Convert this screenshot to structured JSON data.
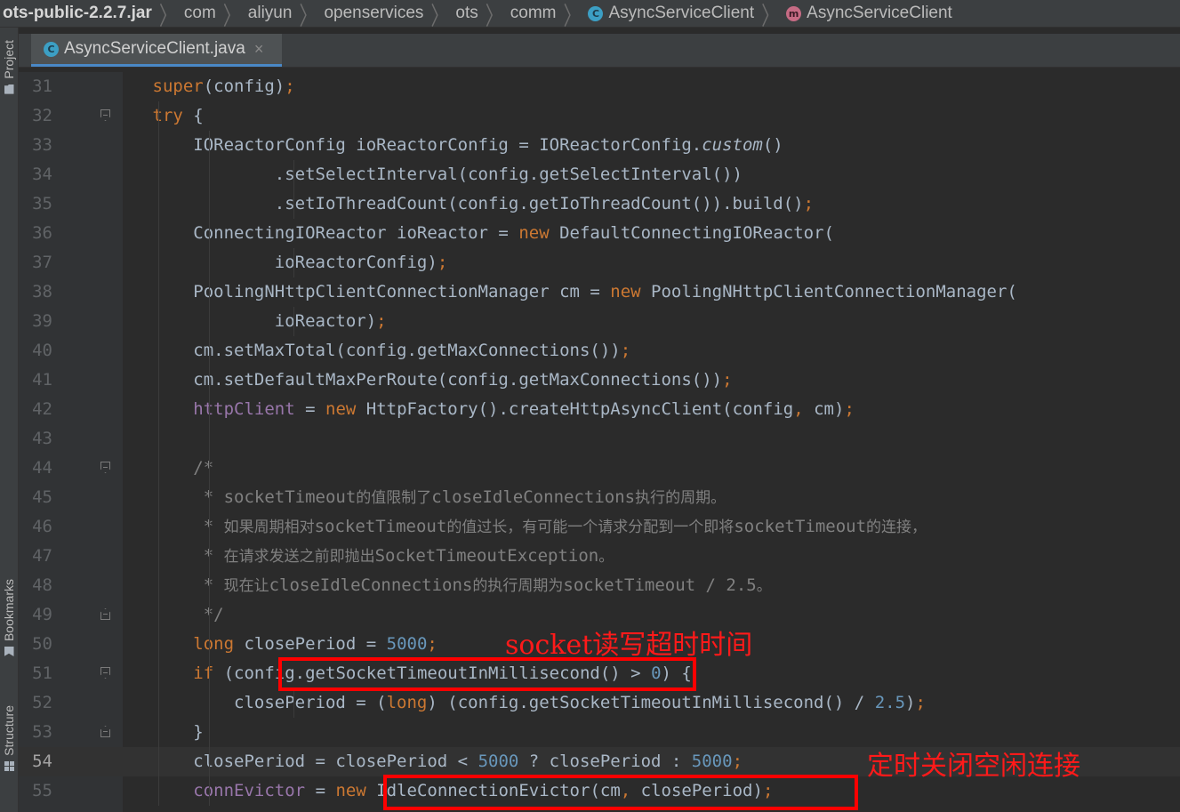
{
  "breadcrumb": {
    "jar": "ots-public-2.2.7.jar",
    "packages": [
      "com",
      "aliyun",
      "openservices",
      "ots",
      "comm"
    ],
    "class_name": "AsyncServiceClient",
    "method_name": "AsyncServiceClient",
    "class_icon": "class-c-icon",
    "method_icon": "method-m-icon",
    "separator": "〉"
  },
  "tool_window_bar": {
    "project_label": "Project",
    "bookmarks_label": "Bookmarks",
    "structure_label": "Structure"
  },
  "tab": {
    "file_name": "AsyncServiceClient.java",
    "close_glyph": "×",
    "icon_letter": "C",
    "method_icon_letter": "m"
  },
  "editor": {
    "current_line": "54",
    "lines": [
      {
        "num": "31",
        "code": [
          [
            "",
            "        "
          ],
          [
            "k",
            "super"
          ],
          [
            "",
            "(config)"
          ],
          [
            "k",
            ";"
          ]
        ]
      },
      {
        "num": "32",
        "code": [
          [
            "",
            "        "
          ],
          [
            "k",
            "try"
          ],
          [
            "",
            " {"
          ]
        ]
      },
      {
        "num": "33",
        "code": [
          [
            "",
            "            IOReactorConfig ioReactorConfig = IOReactorConfig."
          ],
          [
            "i",
            "custom"
          ],
          [
            "",
            "()"
          ]
        ]
      },
      {
        "num": "34",
        "code": [
          [
            "",
            "                    .setSelectInterval(config.getSelectInterval())"
          ]
        ]
      },
      {
        "num": "35",
        "code": [
          [
            "",
            "                    .setIoThreadCount(config.getIoThreadCount()).build()"
          ],
          [
            "k",
            ";"
          ]
        ]
      },
      {
        "num": "36",
        "code": [
          [
            "",
            "            ConnectingIOReactor ioReactor = "
          ],
          [
            "k",
            "new"
          ],
          [
            "",
            " DefaultConnectingIOReactor("
          ]
        ]
      },
      {
        "num": "37",
        "code": [
          [
            "",
            "                    ioReactorConfig)"
          ],
          [
            "k",
            ";"
          ]
        ]
      },
      {
        "num": "38",
        "code": [
          [
            "",
            "            PoolingNHttpClientConnectionManager cm = "
          ],
          [
            "k",
            "new"
          ],
          [
            "",
            " PoolingNHttpClientConnectionManager("
          ]
        ]
      },
      {
        "num": "39",
        "code": [
          [
            "",
            "                    ioReactor)"
          ],
          [
            "k",
            ";"
          ]
        ]
      },
      {
        "num": "40",
        "code": [
          [
            "",
            "            cm.setMaxTotal(config.getMaxConnections())"
          ],
          [
            "k",
            ";"
          ]
        ]
      },
      {
        "num": "41",
        "code": [
          [
            "",
            "            cm.setDefaultMaxPerRoute(config.getMaxConnections())"
          ],
          [
            "k",
            ";"
          ]
        ]
      },
      {
        "num": "42",
        "code": [
          [
            "",
            "            "
          ],
          [
            "f",
            "httpClient"
          ],
          [
            "",
            " = "
          ],
          [
            "k",
            "new"
          ],
          [
            "",
            " HttpFactory().createHttpAsyncClient(config"
          ],
          [
            "k",
            ","
          ],
          [
            "",
            " cm)"
          ],
          [
            "k",
            ";"
          ]
        ]
      },
      {
        "num": "43",
        "code": [
          [
            "",
            ""
          ]
        ]
      },
      {
        "num": "44",
        "code": [
          [
            "cm",
            "            /*"
          ]
        ]
      },
      {
        "num": "45",
        "code": [
          [
            "cm",
            "             * socketTimeout"
          ],
          [
            "cmcn",
            "的值限制了"
          ],
          [
            "cm",
            "closeIdleConnections"
          ],
          [
            "cmcn",
            "执行的周期。"
          ]
        ]
      },
      {
        "num": "46",
        "code": [
          [
            "cm",
            "             * "
          ],
          [
            "cmcn",
            "如果周期相对"
          ],
          [
            "cm",
            "socketTimeout"
          ],
          [
            "cmcn",
            "的值过长，有可能一个请求分配到一个即将"
          ],
          [
            "cm",
            "socketTimeout"
          ],
          [
            "cmcn",
            "的连接，"
          ]
        ]
      },
      {
        "num": "47",
        "code": [
          [
            "cm",
            "             * "
          ],
          [
            "cmcn",
            "在请求发送之前即抛出"
          ],
          [
            "cm",
            "SocketTimeoutException"
          ],
          [
            "cmcn",
            "。"
          ]
        ]
      },
      {
        "num": "48",
        "code": [
          [
            "cm",
            "             * "
          ],
          [
            "cmcn",
            "现在让"
          ],
          [
            "cm",
            "closeIdleConnections"
          ],
          [
            "cmcn",
            "的执行周期为"
          ],
          [
            "cm",
            "socketTimeout / 2.5"
          ],
          [
            "cmcn",
            "。"
          ]
        ]
      },
      {
        "num": "49",
        "code": [
          [
            "cm",
            "             */"
          ]
        ]
      },
      {
        "num": "50",
        "code": [
          [
            "",
            "            "
          ],
          [
            "k",
            "long"
          ],
          [
            "",
            " closePeriod = "
          ],
          [
            "n",
            "5000"
          ],
          [
            "k",
            ";"
          ]
        ]
      },
      {
        "num": "51",
        "code": [
          [
            "",
            "            "
          ],
          [
            "k",
            "if"
          ],
          [
            "",
            " (config.getSocketTimeoutInMillisecond() > "
          ],
          [
            "n",
            "0"
          ],
          [
            "",
            ") {"
          ]
        ]
      },
      {
        "num": "52",
        "code": [
          [
            "",
            "                closePeriod = ("
          ],
          [
            "k",
            "long"
          ],
          [
            "",
            ") (config.getSocketTimeoutInMillisecond() / "
          ],
          [
            "n",
            "2.5"
          ],
          [
            "",
            ")"
          ],
          [
            "k",
            ";"
          ]
        ]
      },
      {
        "num": "53",
        "code": [
          [
            "",
            "            }"
          ]
        ]
      },
      {
        "num": "54",
        "code": [
          [
            "",
            "            closePeriod = closePeriod < "
          ],
          [
            "n",
            "5000"
          ],
          [
            "",
            " ? closePeriod : "
          ],
          [
            "n",
            "5000"
          ],
          [
            "k",
            ";"
          ]
        ]
      },
      {
        "num": "55",
        "code": [
          [
            "",
            "            "
          ],
          [
            "f",
            "connEvictor"
          ],
          [
            "",
            " = "
          ],
          [
            "k",
            "new"
          ],
          [
            "",
            " IdleConnectionEvictor(cm"
          ],
          [
            "k",
            ","
          ],
          [
            "",
            " closePeriod)"
          ],
          [
            "k",
            ";"
          ]
        ]
      }
    ]
  },
  "annotations": {
    "socket_timeout_note": "socket读写超时时间",
    "evictor_note": "定时关闭空闲连接"
  },
  "colors": {
    "keyword": "#cc7832",
    "number": "#6897bb",
    "field": "#9876aa",
    "comment": "#808080",
    "text": "#a9b7c6",
    "annotation_red": "#ff0000"
  }
}
